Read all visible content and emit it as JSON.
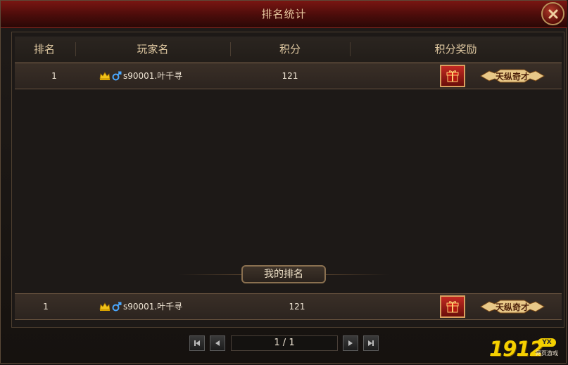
{
  "window": {
    "title": "排名统计"
  },
  "table": {
    "headers": [
      "排名",
      "玩家名",
      "积分",
      "积分奖励"
    ],
    "rows": [
      {
        "rank": "1",
        "player": "s90001.叶千寻",
        "score": "121",
        "badge": "天纵奇才"
      }
    ]
  },
  "my_rank": {
    "label": "我的排名",
    "row": {
      "rank": "1",
      "player": "s90001.叶千寻",
      "score": "121",
      "badge": "天纵奇才"
    }
  },
  "pagination": {
    "page_text": "1 / 1"
  },
  "logo": {
    "number": "1912",
    "yx": "YX",
    "subtitle": "网页游戏"
  },
  "colors": {
    "title_red": "#7a1612",
    "gold": "#f5d000",
    "accent_border": "#b8925a"
  }
}
